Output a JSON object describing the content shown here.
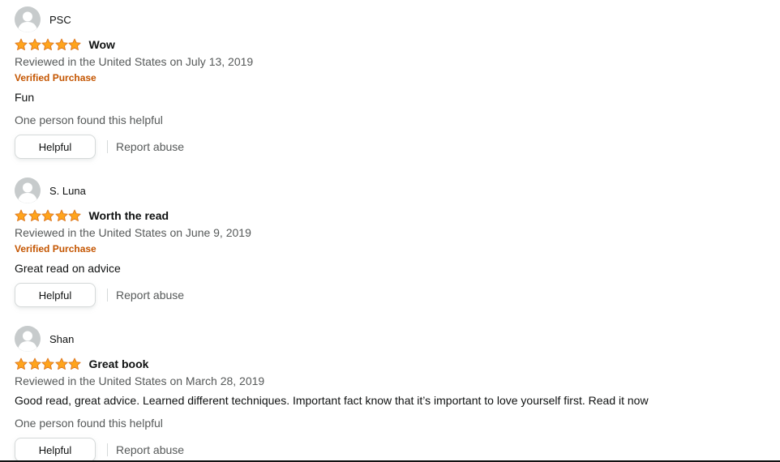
{
  "colors": {
    "star": "#ffa41c",
    "star_outline": "#de7921",
    "verified": "#c45500",
    "secondary_text": "#565959"
  },
  "reviews": [
    {
      "author": "PSC",
      "rating": 5,
      "title": "Wow",
      "date": "Reviewed in the United States on July 13, 2019",
      "verified": "Verified Purchase",
      "body": "Fun",
      "helpful_count": "One person found this helpful",
      "helpful_label": "Helpful",
      "report_label": "Report abuse"
    },
    {
      "author": "S. Luna",
      "rating": 5,
      "title": "Worth the read",
      "date": "Reviewed in the United States on June 9, 2019",
      "verified": "Verified Purchase",
      "body": "Great read on advice",
      "helpful_label": "Helpful",
      "report_label": "Report abuse"
    },
    {
      "author": "Shan",
      "rating": 5,
      "title": "Great book",
      "date": "Reviewed in the United States on March 28, 2019",
      "body": "Good read, great advice. Learned different techniques. Important fact know that it’s important to love yourself first. Read it now",
      "helpful_count": "One person found this helpful",
      "helpful_label": "Helpful",
      "report_label": "Report abuse"
    }
  ]
}
